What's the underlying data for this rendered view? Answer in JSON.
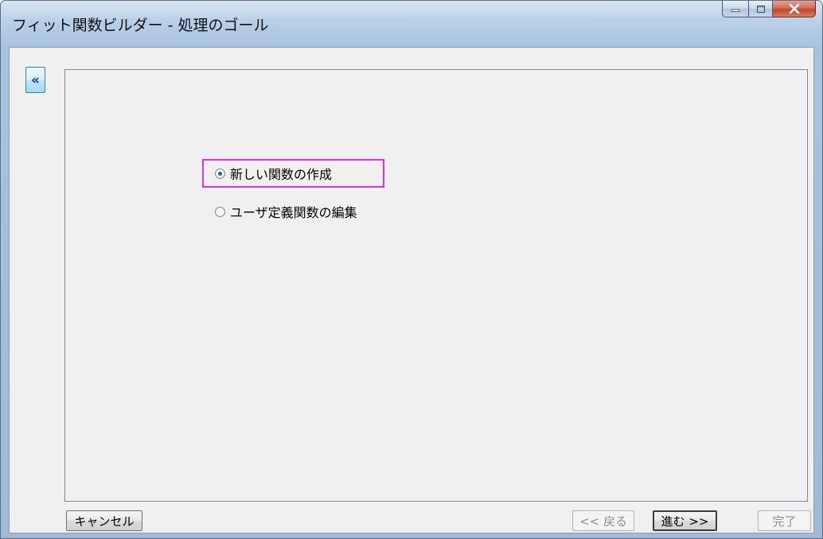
{
  "window": {
    "title": "フィット関数ビルダー - 処理のゴール",
    "minimize_icon": "minimize-icon",
    "maximize_icon": "maximize-icon",
    "close_icon": "close-icon"
  },
  "sidebar": {
    "collapse_label": "«"
  },
  "goal_options": [
    {
      "label": "新しい関数の作成",
      "selected": true
    },
    {
      "label": "ユーザ定義関数の編集",
      "selected": false
    }
  ],
  "buttons": {
    "cancel": "キャンセル",
    "back": "<< 戻る",
    "next": "進む >>",
    "finish": "完了"
  },
  "colors": {
    "highlight": "#e62ee0",
    "close_button": "#c0442c",
    "accent": "#3c7fb1"
  }
}
